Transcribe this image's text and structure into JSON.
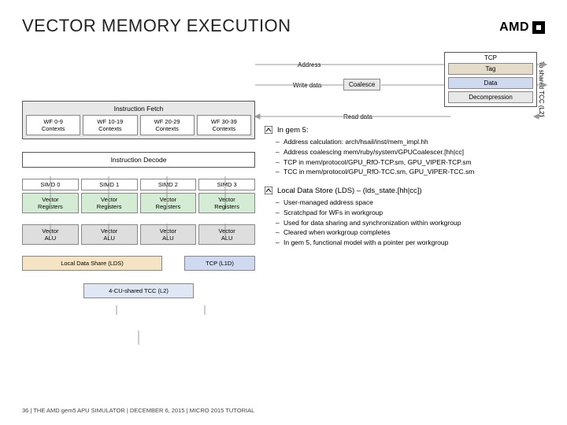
{
  "title": "VECTOR MEMORY EXECUTION",
  "logo": "AMD",
  "tcp": {
    "title": "TCP",
    "tag": "Tag",
    "data": "Data",
    "decomp": "Decompression",
    "address": "Address",
    "write": "Write data",
    "read": "Read data",
    "coalesce": "Coalesce",
    "side": "To shared TCC (L2)"
  },
  "ifetch": {
    "header": "Instruction Fetch",
    "wfs": [
      "WF 0-9\nContexts",
      "WF 10-19\nContexts",
      "WF 20-29\nContexts",
      "WF 30-39\nContexts"
    ]
  },
  "idec": "Instruction Decode",
  "simd": [
    "SIMD 0",
    "SIMD 1",
    "SIMD 2",
    "SIMD 3"
  ],
  "vreg": "Vector\nRegisters",
  "valu": "Vector\nALU",
  "lds": "Local Data Share (LDS)",
  "tcp_bot": "TCP (L1D)",
  "tcc": "4-CU-shared TCC (L2)",
  "bullets": {
    "b1": "In gem 5:",
    "b1subs": [
      "Address calculation: arch/hsail/inst/mem_impl.hh",
      "Address coalescing mem/ruby/system/GPUCoalescer.[hh|cc]",
      "TCP in mem/protocol/GPU_RfO-TCP.sm, GPU_VIPER-TCP.sm",
      "TCC in mem/protocol/GPU_RfO-TCC.sm, GPU_VIPER-TCC.sm"
    ],
    "b2": "Local Data Store (LDS) – (lds_state.[hh|cc])",
    "b2subs": [
      "User-managed address space",
      "Scratchpad for WFs in workgroup",
      "Used for data sharing and synchronization within workgroup",
      "Cleared when workgroup completes",
      "In gem 5, functional model with a pointer per workgroup"
    ]
  },
  "footer": "36  |  THE AMD gem5 APU SIMULATOR  |  DECEMBER 6, 2015  |  MICRO 2015 TUTORIAL"
}
